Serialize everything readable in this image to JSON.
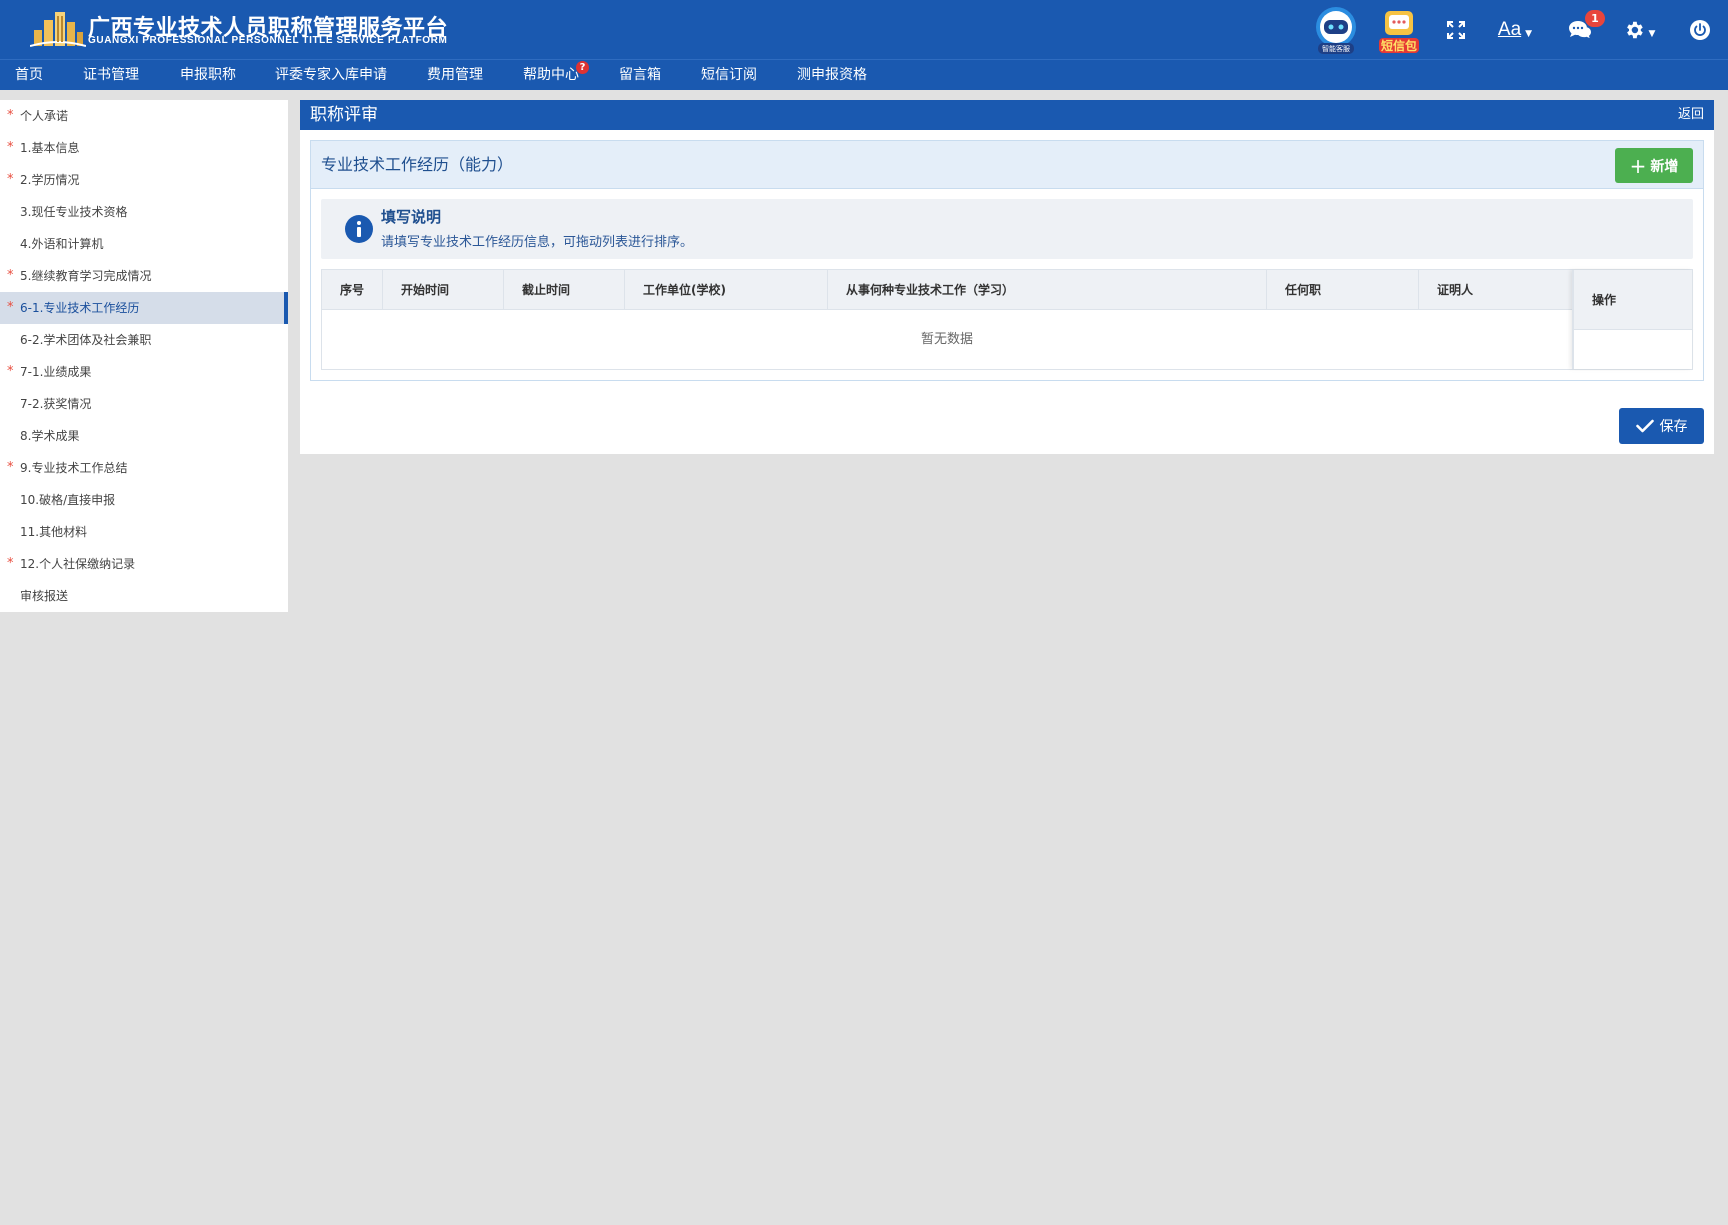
{
  "header": {
    "title": "广西专业技术人员职称管理服务平台",
    "subtitle": "GUANGXI PROFESSIONAL PERSONNEL TITLE SERVICE PLATFORM",
    "robot_label": "智能客服",
    "sms_pack_label": "短信包",
    "font_label": "Aa",
    "message_count": "1",
    "brand_color": "#1a59b0"
  },
  "nav": {
    "items": [
      "首页",
      "证书管理",
      "申报职称",
      "评委专家入库申请",
      "费用管理",
      "帮助中心",
      "留言箱",
      "短信订阅",
      "测申报资格"
    ],
    "help_badge": "?"
  },
  "sidebar": {
    "items": [
      {
        "label": "个人承诺",
        "required": "*"
      },
      {
        "label": "1.基本信息",
        "required": "*"
      },
      {
        "label": "2.学历情况",
        "required": "*"
      },
      {
        "label": "3.现任专业技术资格",
        "required": ""
      },
      {
        "label": "4.外语和计算机",
        "required": ""
      },
      {
        "label": "5.继续教育学习完成情况",
        "required": "*"
      },
      {
        "label": "6-1.专业技术工作经历",
        "required": "*"
      },
      {
        "label": "6-2.学术团体及社会兼职",
        "required": ""
      },
      {
        "label": "7-1.业绩成果",
        "required": "*"
      },
      {
        "label": "7-2.获奖情况",
        "required": ""
      },
      {
        "label": "8.学术成果",
        "required": ""
      },
      {
        "label": "9.专业技术工作总结",
        "required": "*"
      },
      {
        "label": "10.破格/直接申报",
        "required": ""
      },
      {
        "label": "11.其他材料",
        "required": ""
      },
      {
        "label": "12.个人社保缴纳记录",
        "required": "*"
      },
      {
        "label": "审核报送",
        "required": ""
      }
    ]
  },
  "main": {
    "title": "职称评审",
    "back_label": "返回",
    "card_title": "专业技术工作经历（能力）",
    "add_label": "新增",
    "notice_title": "填写说明",
    "notice_text": "请填写专业技术工作经历信息，可拖动列表进行排序。",
    "table": {
      "columns": [
        "序号",
        "开始时间",
        "截止时间",
        "工作单位(学校)",
        "从事何种专业技术工作（学习）",
        "任何职",
        "证明人"
      ],
      "ops_column": "操作",
      "empty_text": "暂无数据"
    },
    "save_label": "保存"
  }
}
